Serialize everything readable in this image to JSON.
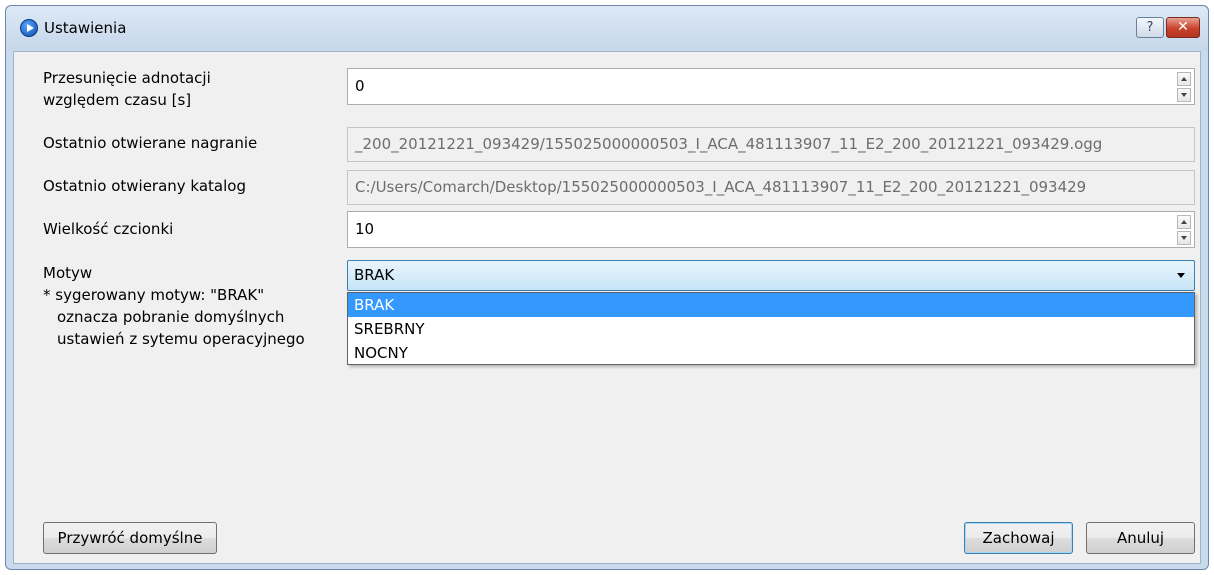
{
  "window": {
    "title": "Ustawienia",
    "help_label": "?",
    "close_label": "✕"
  },
  "fields": {
    "offset": {
      "label_line1": "Przesunięcie adnotacji",
      "label_line2": "względem czasu [s]",
      "value": "0"
    },
    "last_recording": {
      "label": "Ostatnio otwierane nagranie",
      "value": "_200_20121221_093429/155025000000503_I_ACA_481113907_11_E2_200_20121221_093429.ogg"
    },
    "last_directory": {
      "label": "Ostatnio otwierany katalog",
      "value": "C:/Users/Comarch/Desktop/155025000000503_I_ACA_481113907_11_E2_200_20121221_093429"
    },
    "font_size": {
      "label": "Wielkość czcionki",
      "value": "10"
    },
    "theme": {
      "label": "Motyw",
      "note_line1": "* sygerowany motyw: \"BRAK\"",
      "note_line2": "oznacza pobranie domyślnych",
      "note_line3": "ustawień z sytemu operacyjnego",
      "selected": "BRAK",
      "options": [
        "BRAK",
        "SREBRNY",
        "NOCNY"
      ]
    }
  },
  "buttons": {
    "restore_defaults": "Przywróć domyślne",
    "save": "Zachowaj",
    "cancel": "Anuluj"
  },
  "colors": {
    "selection": "#3399ff",
    "title_bar": "#c9daec",
    "close_button": "#c8432c"
  }
}
